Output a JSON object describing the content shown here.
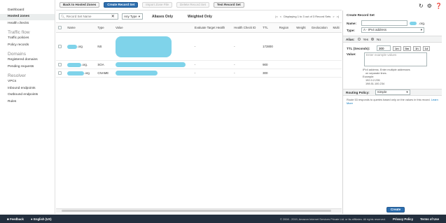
{
  "sidebar": {
    "items": [
      {
        "label": "Dashboard"
      },
      {
        "label": "Hosted zones"
      },
      {
        "label": "Health checks"
      }
    ],
    "traffic_flow": {
      "title": "Traffic flow",
      "items": [
        "Traffic policies",
        "Policy records"
      ]
    },
    "domains": {
      "title": "Domains",
      "items": [
        "Registered domains",
        "Pending requests"
      ]
    },
    "resolver": {
      "title": "Resolver",
      "items": [
        "VPCs",
        "Inbound endpoints",
        "Outbound endpoints",
        "Rules"
      ]
    }
  },
  "toolbar": {
    "back": "Back to Hosted Zones",
    "create": "Create Record Set",
    "import": "Import Zone File",
    "delete": "Delete Record Set",
    "test": "Test Record Set"
  },
  "filter": {
    "search_placeholder": "Record Set Name",
    "any_type": "Any Type",
    "aliases_only": "Aliases Only",
    "weighted_only": "Weighted Only",
    "pager_text": "Displaying 1 to 3 out of 3 Record Sets"
  },
  "table": {
    "columns": [
      "Name",
      "Type",
      "Value",
      "Evaluate Target Health",
      "Health Check ID",
      "TTL",
      "Region",
      "Weight",
      "Geolocation",
      "Multi"
    ],
    "rows": [
      {
        "name": ".org",
        "type": "NS",
        "value": "",
        "eval": "-",
        "health": "-",
        "ttl": "172800"
      },
      {
        "name": ".org.",
        "type": "SOA",
        "value": "",
        "eval": "-",
        "health": "-",
        "ttl": "900"
      },
      {
        "name": ".org",
        "type": "CNAME",
        "value": "",
        "eval": "-",
        "health": "-",
        "ttl": "300"
      }
    ]
  },
  "panel": {
    "title": "Create Record Set",
    "name_label": "Name:",
    "name_suffix": ".org.",
    "type_label": "Type:",
    "type_value": "A - IPv4 address",
    "alias_label": "Alias:",
    "alias_yes": "Yes",
    "alias_no": "No",
    "ttl_label": "TTL (Seconds):",
    "ttl_value": "300",
    "ttl_buttons": [
      "1m",
      "5m",
      "1h",
      "1d"
    ],
    "value_label": "Value:",
    "value_placeholder": "Enter example values",
    "hint_lines": [
      "IPv4 address. Enter multiple addresses",
      "on separate lines.",
      "Example:",
      "192.0.2.235",
      "198.51.100.234"
    ],
    "routing_label": "Routing Policy:",
    "routing_value": "Simple",
    "routing_hint": "Route 53 responds to queries based only on the values in this record.",
    "learn_more": "Learn More",
    "create_button": "Create"
  },
  "footer": {
    "feedback": "Feedback",
    "language": "English (US)",
    "copyright": "© 2008 - 2019, Amazon Internet Services Private Ltd. or its affiliates. All rights reserved.",
    "privacy": "Privacy Policy",
    "terms": "Terms of Use"
  }
}
